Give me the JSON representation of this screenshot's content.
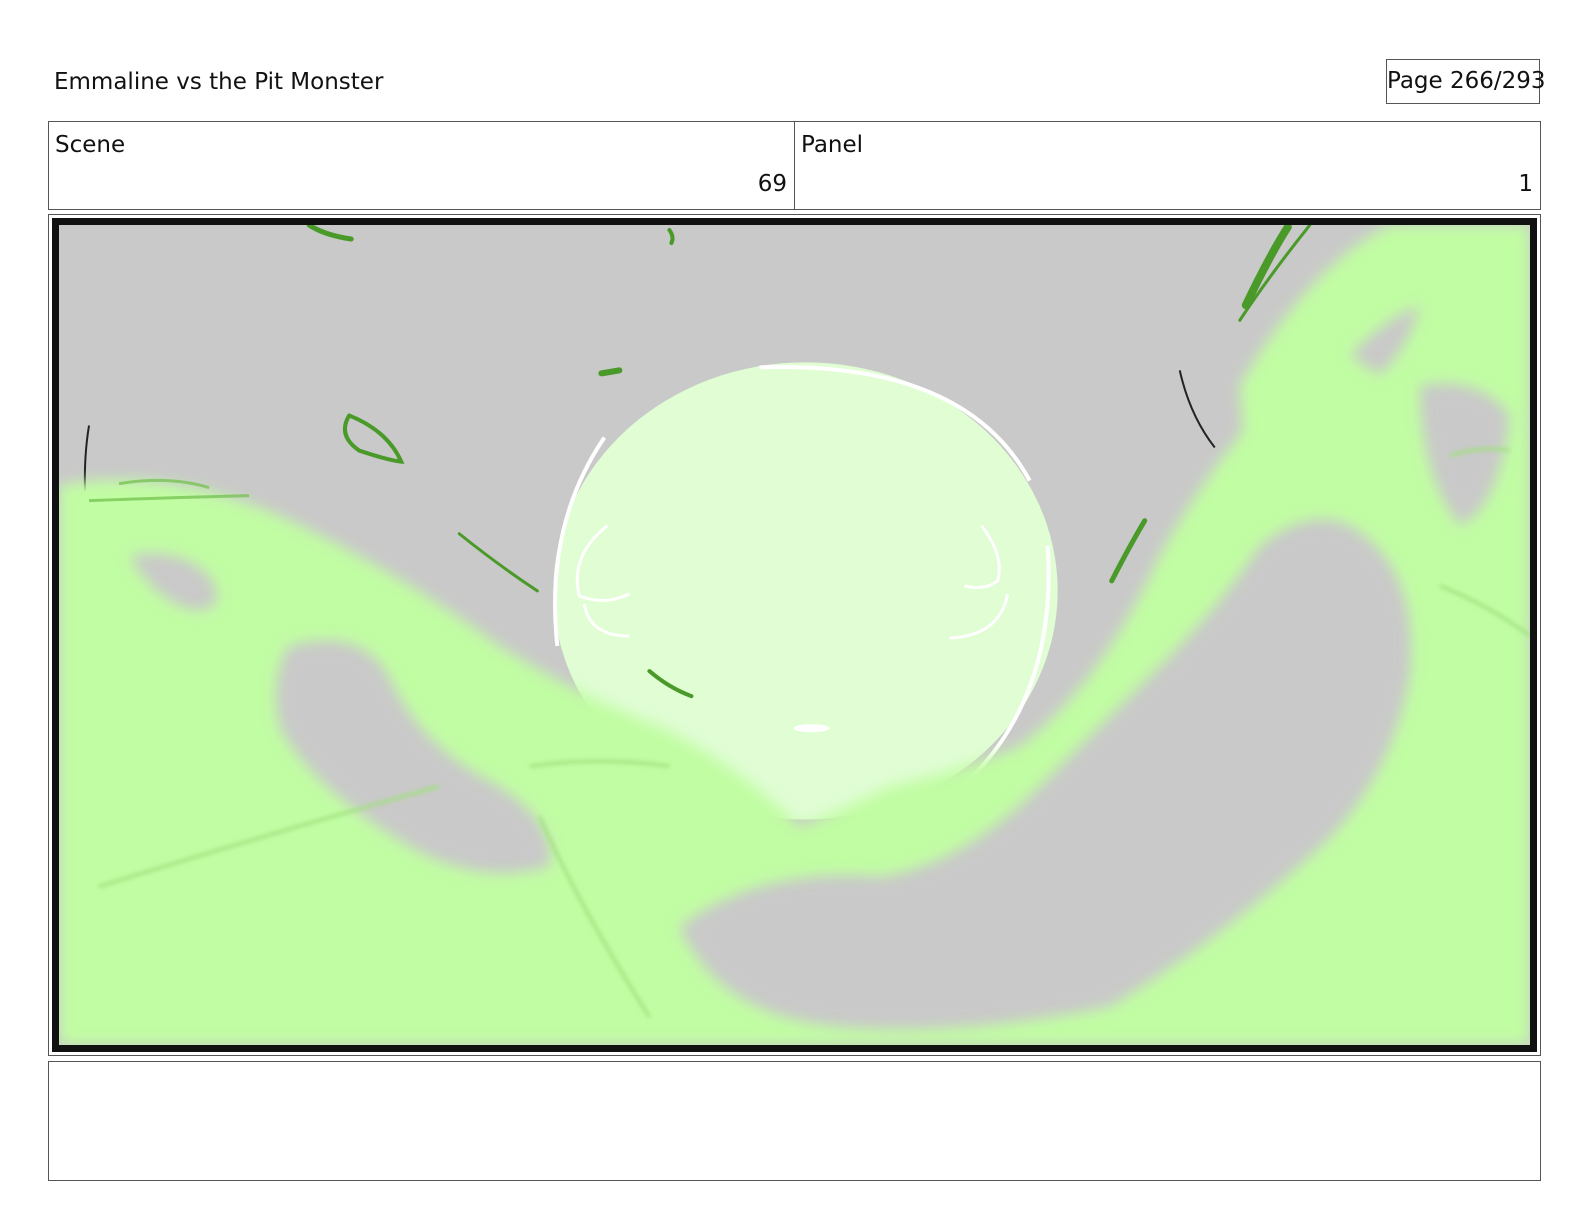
{
  "header": {
    "title": "Emmaline vs the Pit Monster",
    "page_label": "Page 266/293"
  },
  "info": {
    "scene_label": "Scene",
    "scene_value": "69",
    "panel_label": "Panel",
    "panel_value": "1"
  },
  "colors": {
    "background_gray": "#c9c9c9",
    "slime_green": "#c1fda3",
    "orb_fill": "#e0fdd4",
    "stroke_green": "#4a9a2a",
    "frame_border": "#111111"
  },
  "notes": {
    "text": ""
  }
}
